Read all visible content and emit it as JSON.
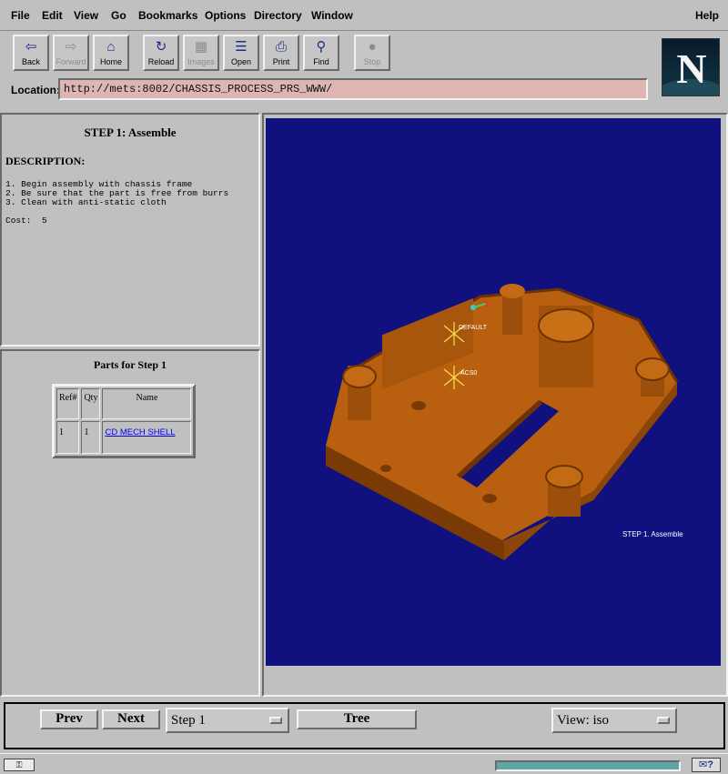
{
  "menubar": {
    "items": [
      "File",
      "Edit",
      "View",
      "Go",
      "Bookmarks",
      "Options",
      "Directory",
      "Window"
    ],
    "help": "Help"
  },
  "toolbar": {
    "buttons": [
      {
        "label": "Back",
        "icon": "back-arrow-icon",
        "enabled": true
      },
      {
        "label": "Forward",
        "icon": "forward-arrow-icon",
        "enabled": false
      },
      {
        "label": "Home",
        "icon": "home-icon",
        "enabled": true
      },
      {
        "label": "Reload",
        "icon": "reload-icon",
        "enabled": true
      },
      {
        "label": "Images",
        "icon": "images-icon",
        "enabled": false
      },
      {
        "label": "Open",
        "icon": "open-icon",
        "enabled": true
      },
      {
        "label": "Print",
        "icon": "print-icon",
        "enabled": true
      },
      {
        "label": "Find",
        "icon": "find-icon",
        "enabled": true
      },
      {
        "label": "Stop",
        "icon": "stop-icon",
        "enabled": false
      }
    ],
    "logo_letter": "N"
  },
  "location": {
    "label": "Location:",
    "url": "http://mets:8002/CHASSIS_PROCESS_PRS_WWW/"
  },
  "step": {
    "title": "STEP 1: Assemble",
    "description_heading": "DESCRIPTION:",
    "description_lines": [
      "1. Begin assembly with chassis frame",
      "2. Be sure that the part is free from burrs",
      "3. Clean with anti-static cloth"
    ],
    "cost_label": "Cost:",
    "cost_value": "5"
  },
  "parts": {
    "title": "Parts for Step 1",
    "columns": [
      "Ref#",
      "Qty",
      "Name"
    ],
    "rows": [
      {
        "ref": "1",
        "qty": "1",
        "name": "CD MECH SHELL"
      }
    ]
  },
  "viewport": {
    "background": "#10107f",
    "part_color": "#b8600f",
    "labels": {
      "default": "DEFAULT",
      "acs": "ACS0",
      "caption": "STEP 1. Assemble"
    }
  },
  "controls": {
    "prev": "Prev",
    "next": "Next",
    "step_select": "Step 1",
    "tree": "Tree",
    "view_select": "View: iso"
  },
  "status": {
    "security_icon": "security-key-icon",
    "mail_icon": "mail-icon"
  }
}
